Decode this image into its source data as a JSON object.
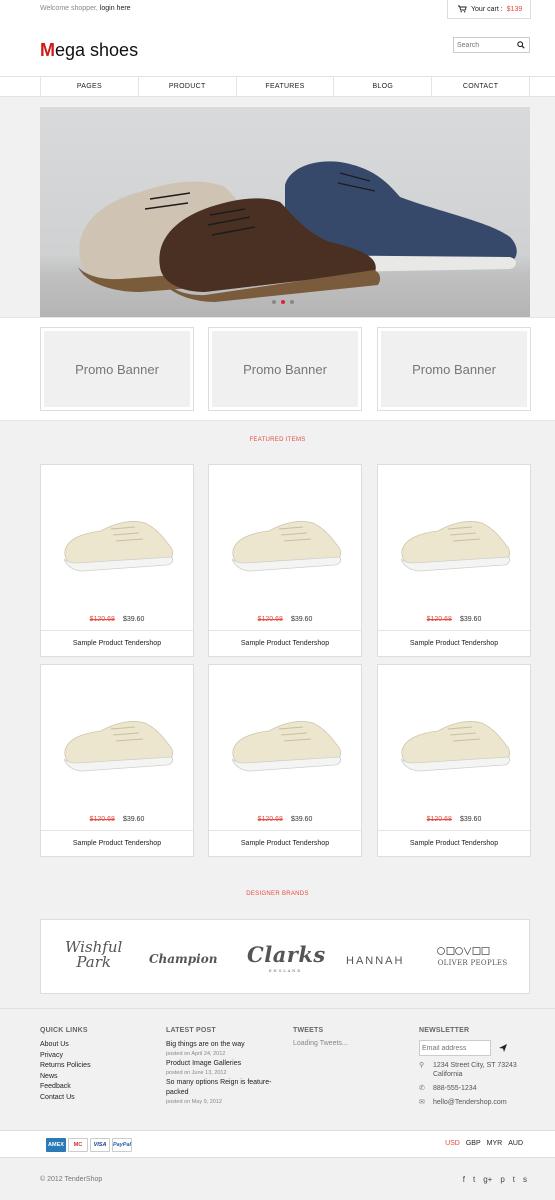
{
  "topbar": {
    "welcome": "Welcome shopper,",
    "login": "login here",
    "cart_label": "Your cart :",
    "cart_amount": "$139"
  },
  "header": {
    "logo_first": "M",
    "logo_rest": "ega shoes",
    "search_placeholder": "Search"
  },
  "nav": [
    "PAGES",
    "PRODUCT",
    "FEATURES",
    "BLOG",
    "CONTACT"
  ],
  "promos": [
    "Promo Banner",
    "Promo Banner",
    "Promo Banner"
  ],
  "featured_title": "FEATURED ITEMS",
  "products": [
    {
      "old": "$120.68",
      "price": "$39.60",
      "name": "Sample Product Tendershop"
    },
    {
      "old": "$120.68",
      "price": "$39.60",
      "name": "Sample Product Tendershop"
    },
    {
      "old": "$120.68",
      "price": "$39.60",
      "name": "Sample Product Tendershop"
    },
    {
      "old": "$120.68",
      "price": "$39.60",
      "name": "Sample Product Tendershop"
    },
    {
      "old": "$120.68",
      "price": "$39.60",
      "name": "Sample Product Tendershop"
    },
    {
      "old": "$120.68",
      "price": "$39.60",
      "name": "Sample Product Tendershop"
    }
  ],
  "brands_title": "DESIGNER BRANDS",
  "brands": [
    "Wishful",
    "Park",
    "Champion",
    "Clarks",
    "ENGLAND",
    "HANNAH",
    "OLIVER PEOPLES"
  ],
  "footer": {
    "quick_links_title": "QUICK LINKS",
    "quick_links": [
      "About Us",
      "Privacy",
      "Returns Policies",
      "News",
      "Feedback",
      "Contact Us"
    ],
    "latest_title": "LATEST POST",
    "posts": [
      {
        "title": "Big things are on the way",
        "date": "posted on April 24, 2012"
      },
      {
        "title": "Product Image Galleries",
        "date": "posted on June 13, 2012"
      },
      {
        "title": "So many options Reign is feature-packed",
        "date": "posted on May 9, 2012"
      }
    ],
    "tweets_title": "TWEETS",
    "tweets_loading": "Loading Tweets...",
    "newsletter_title": "NEWSLETTER",
    "newsletter_placeholder": "Email address",
    "address": "1234 Street City, ST 73243 California",
    "phone": "888-555-1234",
    "email": "hello@Tendershop.com"
  },
  "payments": [
    "AMEX",
    "MC",
    "VISA",
    "PayPal"
  ],
  "currencies": [
    "USD",
    "GBP",
    "MYR",
    "AUD"
  ],
  "copyright": "© 2012 TenderShop",
  "social": [
    "f",
    "t",
    "g+",
    "p",
    "t",
    "s"
  ],
  "colors": {
    "accent": "#e14d43",
    "logo_red": "#d01a1a"
  }
}
